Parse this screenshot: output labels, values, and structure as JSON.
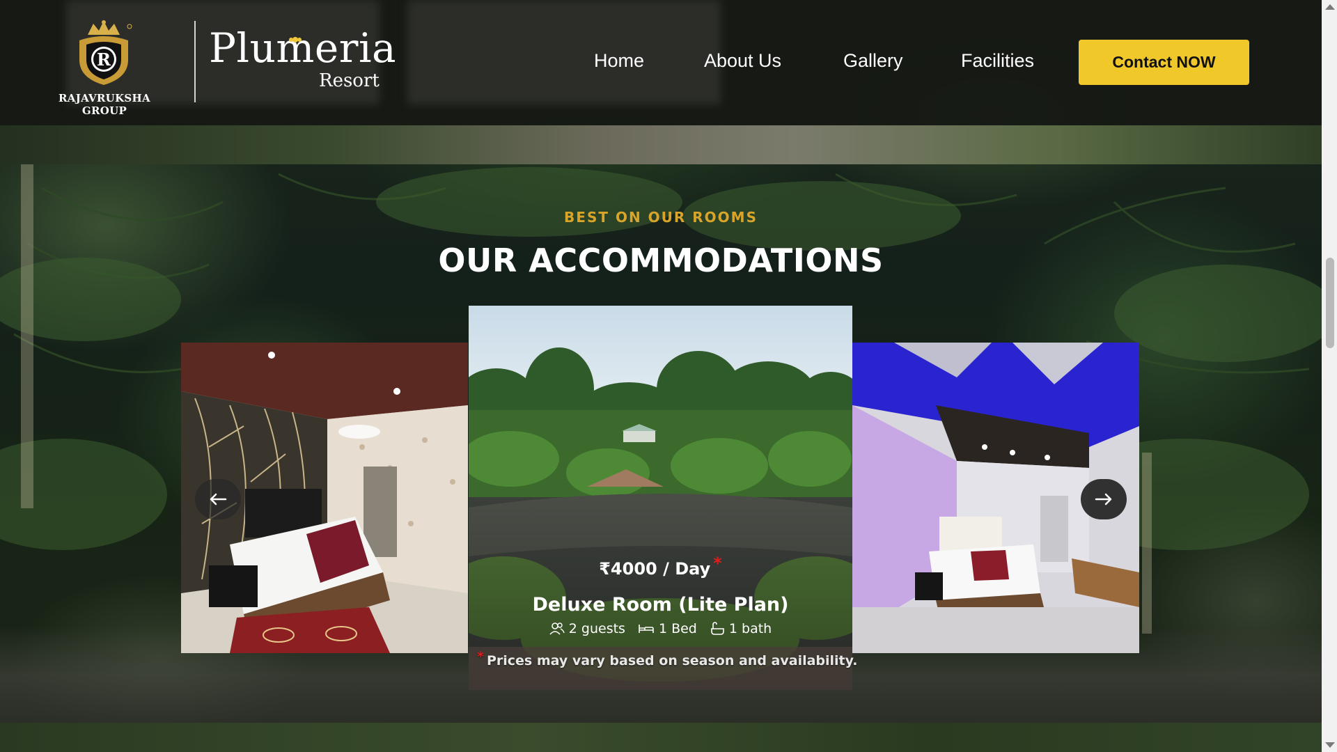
{
  "header": {
    "group_name": "RAJAVRUKSHA GROUP",
    "emblem_letter": "R",
    "brand_name": "Plumeria",
    "brand_sub": "Resort",
    "nav": [
      "Home",
      "About Us",
      "Gallery",
      "Facilities"
    ],
    "contact_label": "Contact NOW",
    "accent_color": "#f1c82a"
  },
  "section": {
    "eyebrow": "BEST ON OUR ROOMS",
    "title": "OUR ACCOMMODATIONS",
    "eyebrow_color": "#d8a52a"
  },
  "carousel": {
    "prev_icon": "arrow-left-icon",
    "next_icon": "arrow-right-icon",
    "active_card": {
      "price": "₹4000 / Day",
      "price_marker": "*",
      "name": "Deluxe Room (Lite Plan)",
      "guests": "2 guests",
      "beds": "1 Bed",
      "baths": "1 bath",
      "note_marker": "*",
      "note": "Prices may vary based on season and availability."
    },
    "marker_color": "#e21b1b"
  }
}
